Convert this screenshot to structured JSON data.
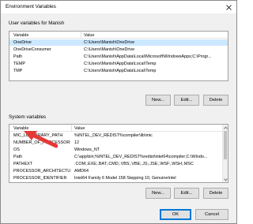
{
  "window": {
    "title": "Environment Variables",
    "close_glyph": "✕"
  },
  "user_vars": {
    "group_title": "User variables for Manish",
    "columns": [
      "Variable",
      "Value"
    ],
    "rows": [
      [
        "OneDrive",
        "C:\\Users\\Manish\\OneDrive"
      ],
      [
        "OneDriveConsumer",
        "C:\\Users\\Manish\\OneDrive"
      ],
      [
        "Path",
        "C:\\Users\\Manish\\AppData\\Local\\Microsoft\\WindowsApps;C:\\Progr..."
      ],
      [
        "TEMP",
        "C:\\Users\\Manish\\AppData\\Local\\Temp"
      ],
      [
        "TMP",
        "C:\\Users\\Manish\\AppData\\Local\\Temp"
      ]
    ],
    "buttons": {
      "new": "New...",
      "edit": "Edit...",
      "delete": "Delete"
    }
  },
  "system_vars": {
    "group_title": "System variables",
    "columns": [
      "Variable",
      "Value"
    ],
    "rows": [
      [
        "MIC_LD_LIBRARY_PATH",
        "%INTEL_DEV_REDIST%compiler\\lib\\mic"
      ],
      [
        "NUMBER_OF_PROCESSORS",
        "12"
      ],
      [
        "OS",
        "Windows_NT"
      ],
      [
        "Path",
        "C:\\app\\bin;%INTEL_DEV_REDIST%redist\\intel64\\compiler;C:\\Windo..."
      ],
      [
        "PATHEXT",
        ".COM;.EXE;.BAT;.CMD;.VBS;.VBE;.JS;.JSE;.WSF;.WSH;.MSC"
      ],
      [
        "PROCESSOR_ARCHITECTURE",
        "AMD64"
      ],
      [
        "PROCESSOR_IDENTIFIER",
        "Intel64 Family 6 Model 158 Stepping 10, GenuineIntel"
      ]
    ],
    "buttons": {
      "new": "New...",
      "edit": "Edit...",
      "delete": "Delete"
    }
  },
  "footer": {
    "ok": "OK",
    "cancel": "Cancel"
  },
  "colors": {
    "selected_row": "#cce8ff",
    "arrow": "#e53935",
    "accent": "#0078d7"
  },
  "icons": {
    "close": "close-icon",
    "annotation": "red-arrow-icon"
  }
}
